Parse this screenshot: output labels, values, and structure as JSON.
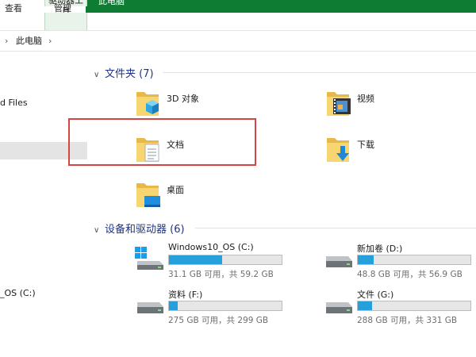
{
  "ribbon": {
    "context_group": "驱动器工具",
    "window_title": "此电脑",
    "tabs": [
      {
        "label": "查看"
      },
      {
        "label": "管理"
      }
    ]
  },
  "address_bar": {
    "separator": "›",
    "path": "此电脑"
  },
  "nav_pane": {
    "partial_items": [
      "d Files",
      "_OS (C:)"
    ]
  },
  "folders_section": {
    "chevron": "∨",
    "title": "文件夹 (7)",
    "items": [
      {
        "label": "3D 对象",
        "icon": "3d-objects-folder-icon"
      },
      {
        "label": "视频",
        "icon": "videos-folder-icon"
      },
      {
        "label": "文档",
        "icon": "documents-folder-icon"
      },
      {
        "label": "下载",
        "icon": "downloads-folder-icon"
      },
      {
        "label": "桌面",
        "icon": "desktop-folder-icon"
      }
    ]
  },
  "devices_section": {
    "chevron": "∨",
    "title": "设备和驱动器 (6)",
    "drives": [
      {
        "name": "Windows10_OS (C:)",
        "info": "31.1 GB 可用，共 59.2 GB",
        "used_fraction": 0.47,
        "icon": "windows-drive-icon"
      },
      {
        "name": "新加卷 (D:)",
        "info": "48.8 GB 可用，共 56.9 GB",
        "used_fraction": 0.14,
        "icon": "hard-drive-icon"
      },
      {
        "name": "资料 (F:)",
        "info": "275 GB 可用，共 299 GB",
        "used_fraction": 0.08,
        "icon": "hard-drive-icon"
      },
      {
        "name": "文件 (G:)",
        "info": "288 GB 可用，共 331 GB",
        "used_fraction": 0.13,
        "icon": "hard-drive-icon"
      }
    ]
  },
  "colors": {
    "ribbon_green": "#0e7d33",
    "section_header": "#1e3287",
    "capacity_bar": "#26a0da",
    "highlight_box": "#d64545"
  }
}
